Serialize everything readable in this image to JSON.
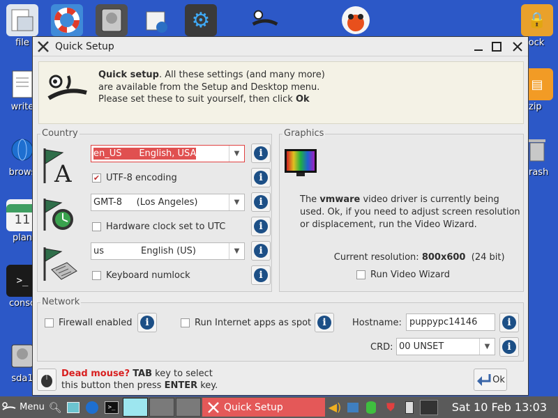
{
  "desktop": {
    "icons": [
      {
        "label": "file"
      },
      {
        "label": "write"
      },
      {
        "label": "brows"
      },
      {
        "label": "plan"
      },
      {
        "label": "conso"
      },
      {
        "label": "sda1"
      },
      {
        "label": "lock"
      },
      {
        "label": "zip"
      },
      {
        "label": "rash"
      }
    ],
    "calendar_day": "11"
  },
  "window": {
    "title": "Quick Setup",
    "intro": {
      "bold_lead": "Quick setup",
      "text": ". All these settings (and many more) are available from the Setup and Desktop menu. Please set these to suit yourself, then click ",
      "bold_end": "Ok"
    },
    "country": {
      "legend": "Country",
      "locale_code": "en_US",
      "locale_name": "English, USA",
      "utf8_label": "UTF-8 encoding",
      "utf8_checked": true,
      "timezone": "GMT-8     (Los Angeles)",
      "hwclock_label": "Hardware clock set to UTC",
      "keyboard_code": "us",
      "keyboard_name": "English (US)",
      "numlock_label": "Keyboard numlock"
    },
    "graphics": {
      "legend": "Graphics",
      "text_pre": "The ",
      "driver": "vmware",
      "text_post": " video driver is currently being used. Ok, if you need to adjust screen resolution or displacement, run the Video Wizard.",
      "resolution_label": "Current resolution: ",
      "resolution": "800x600",
      "depth": "(24 bit)",
      "wizard_label": "Run Video Wizard"
    },
    "network": {
      "legend": "Network",
      "firewall_label": "Firewall enabled",
      "spot_label": "Run Internet apps as spot",
      "hostname_label": "Hostname:",
      "hostname": "puppypc14146",
      "crd_label": "CRD:",
      "crd": "00 UNSET"
    },
    "footer": {
      "dead_mouse": "Dead mouse?",
      "tab": "TAB",
      "text1": " key to select",
      "text2": "this button then press ",
      "enter": "ENTER",
      "text3": " key.",
      "ok_label": "Ok"
    }
  },
  "taskbar": {
    "menu_label": "Menu",
    "task_label": "Quick Setup",
    "clock": "Sat 10 Feb 13:03"
  },
  "colors": {
    "desktop": "#2c58c7",
    "accent_red": "#e05050",
    "info_blue": "#1c4f86",
    "taskbar": "#5a5a5a"
  }
}
